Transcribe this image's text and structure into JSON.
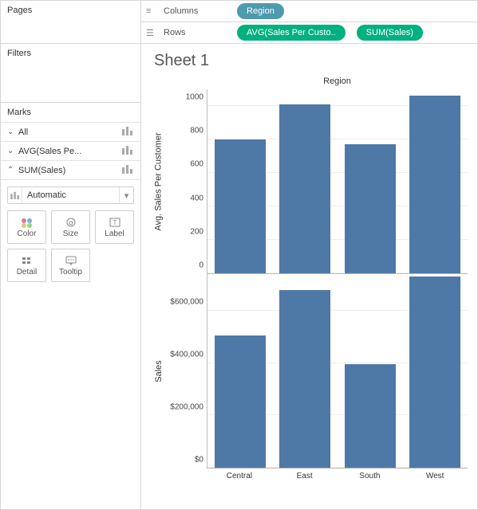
{
  "left": {
    "pages_label": "Pages",
    "filters_label": "Filters",
    "marks_label": "Marks",
    "rows": [
      {
        "label": "All",
        "expanded": false
      },
      {
        "label": "AVG(Sales Pe...",
        "expanded": false
      },
      {
        "label": "SUM(Sales)",
        "expanded": true
      }
    ],
    "mark_type": "Automatic",
    "cells": {
      "color": "Color",
      "size": "Size",
      "label": "Label",
      "detail": "Detail",
      "tooltip": "Tooltip"
    }
  },
  "shelves": {
    "columns_label": "Columns",
    "rows_label": "Rows",
    "columns_pill": "Region",
    "rows_pill1": "AVG(Sales Per Custo..",
    "rows_pill2": "SUM(Sales)"
  },
  "viz": {
    "title": "Sheet 1",
    "region_header": "Region",
    "ylab1": "Avg. Sales Per Customer",
    "ylab2": "Sales"
  },
  "chart_data": [
    {
      "type": "bar",
      "categories": [
        "Central",
        "East",
        "South",
        "West"
      ],
      "values": [
        800,
        1010,
        770,
        1060
      ],
      "title": "Avg. Sales Per Customer by Region",
      "xlabel": "Region",
      "ylabel": "Avg. Sales Per Customer",
      "yticks": [
        0,
        200,
        400,
        600,
        800,
        1000
      ],
      "ylim": [
        0,
        1100
      ]
    },
    {
      "type": "bar",
      "categories": [
        "Central",
        "East",
        "South",
        "West"
      ],
      "values": [
        505000,
        680000,
        395000,
        730000
      ],
      "title": "Sales by Region",
      "xlabel": "Region",
      "ylabel": "Sales",
      "yticks": [
        0,
        200000,
        400000,
        600000
      ],
      "ytick_labels": [
        "$0",
        "$200,000",
        "$400,000",
        "$600,000"
      ],
      "ylim": [
        0,
        740000
      ]
    }
  ]
}
